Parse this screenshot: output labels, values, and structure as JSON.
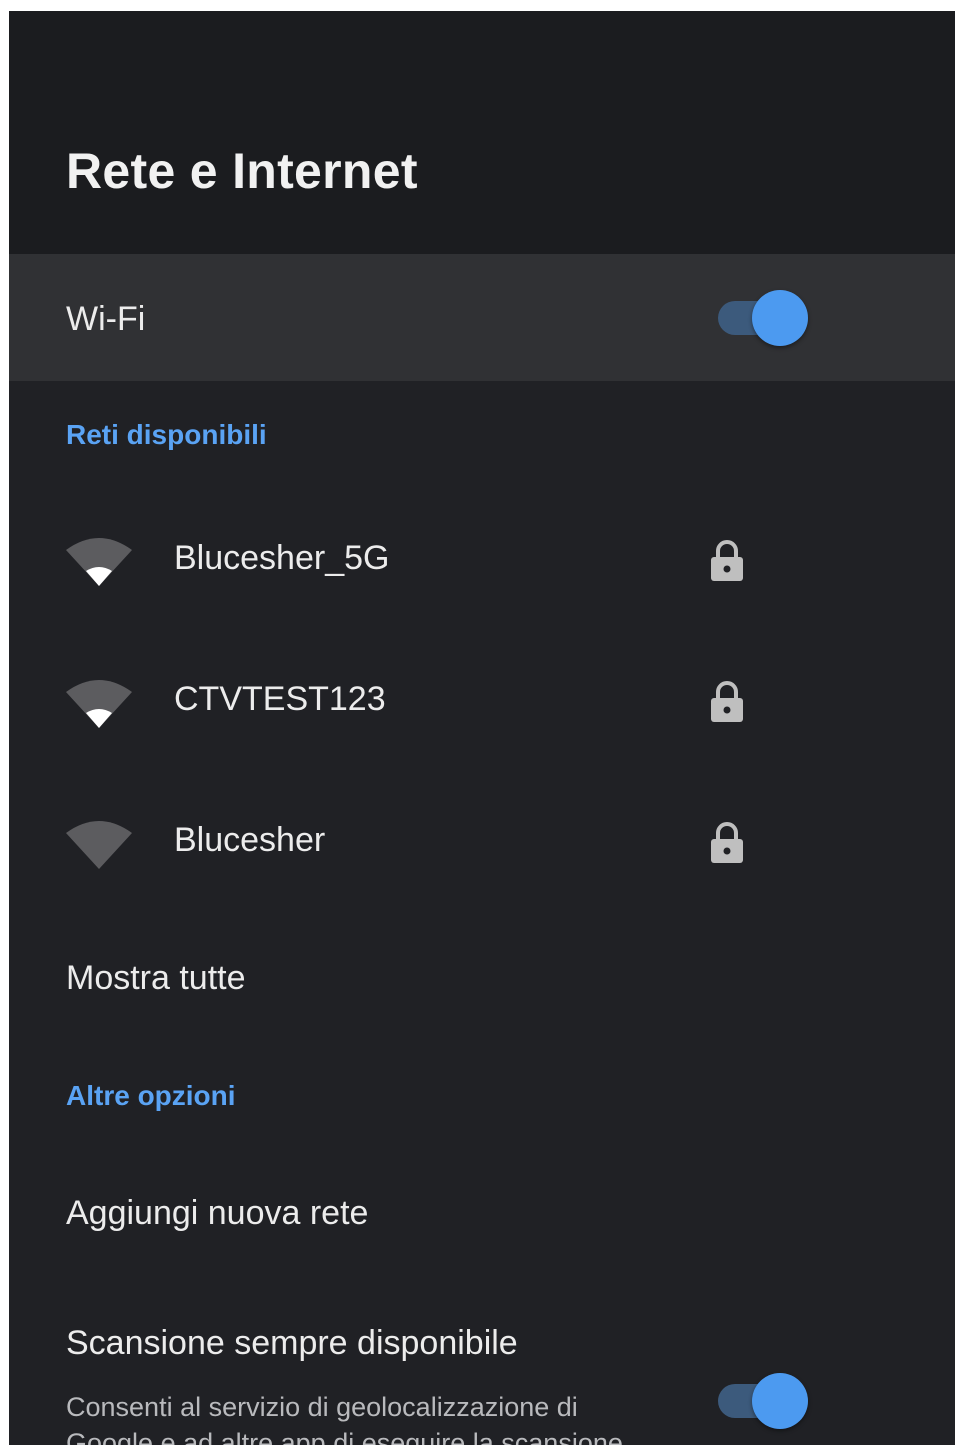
{
  "header": {
    "title": "Rete e Internet"
  },
  "wifi": {
    "label": "Wi-Fi",
    "enabled": true
  },
  "available_section": {
    "title": "Reti disponibili"
  },
  "networks": [
    {
      "name": "Blucesher_5G",
      "signal": "full",
      "secured": true
    },
    {
      "name": "CTVTEST123",
      "signal": "full",
      "secured": true
    },
    {
      "name": "Blucesher",
      "signal": "weak",
      "secured": true
    }
  ],
  "show_all": {
    "label": "Mostra tutte"
  },
  "other_section": {
    "title": "Altre opzioni"
  },
  "add_network": {
    "label": "Aggiungi nuova rete"
  },
  "scan_always": {
    "label": "Scansione sempre disponibile",
    "description_line1": "Consenti al servizio di geolocalizzazione di",
    "description_line2": "Google e ad altre app di eseguire la scansione",
    "enabled": true
  },
  "colors": {
    "accent": "#4c9af0",
    "toggle_track": "#3c5a7c",
    "background": "#202125",
    "header_bg": "#1b1c1f",
    "selected_row": "#303134"
  },
  "icons": {
    "wifi_full": "wifi-signal-full-icon",
    "wifi_weak": "wifi-signal-weak-icon",
    "lock": "lock-icon"
  }
}
